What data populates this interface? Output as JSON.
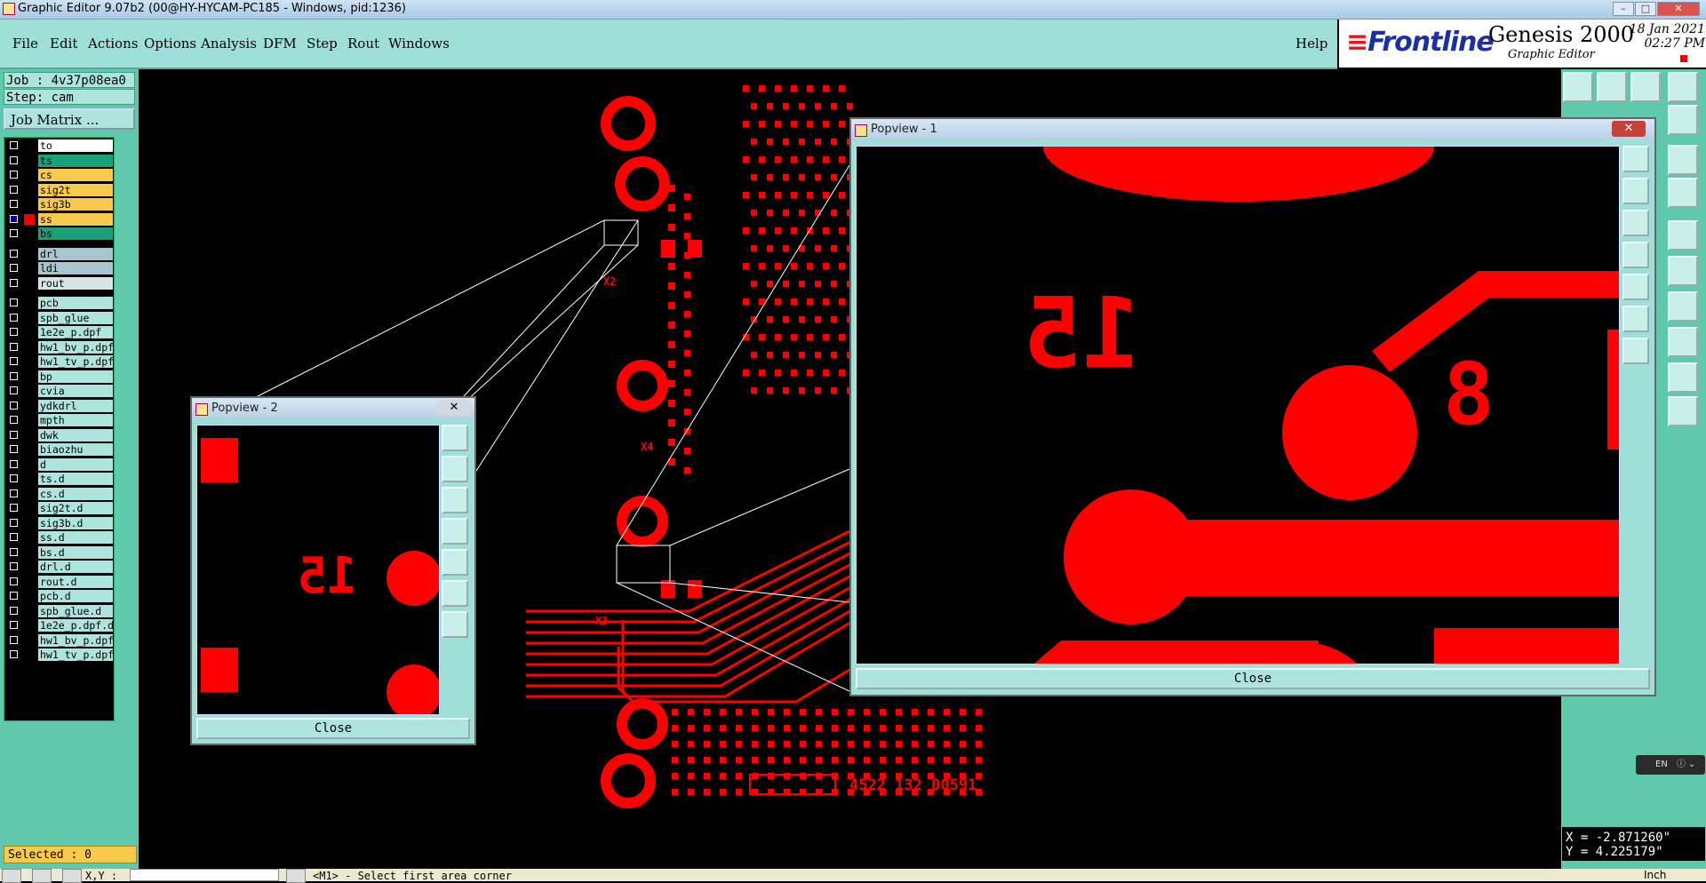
{
  "window": {
    "title": "Graphic Editor 9.07b2 (00@HY-HYCAM-PC185 - Windows, pid:1236)"
  },
  "menubar": {
    "items": [
      "File",
      "Edit",
      "Actions",
      "Options",
      "Analysis",
      "DFM",
      "Step",
      "Rout",
      "Windows"
    ],
    "help": "Help"
  },
  "brand": {
    "frontline": "Frontline",
    "product": "Genesis 2000",
    "subtitle": "Graphic Editor",
    "date": "18 Jan 2021",
    "time": "02:27 PM"
  },
  "job": {
    "job_label": "Job : 4v37p08ea0",
    "step_label": "Step: cam",
    "matrix_button": "Job Matrix ..."
  },
  "layers": [
    {
      "name": "to",
      "color": "#ffffff"
    },
    {
      "name": "ts",
      "color": "#1aa078"
    },
    {
      "name": "cs",
      "color": "#f8c94a"
    },
    {
      "name": "sig2t",
      "color": "#f8c94a"
    },
    {
      "name": "sig3b",
      "color": "#f8c94a"
    },
    {
      "name": "ss",
      "color": "#f8c94a"
    },
    {
      "name": "bs",
      "color": "#1aa078"
    },
    {
      "name": "drl",
      "color": "#a8c4cc"
    },
    {
      "name": "ldi",
      "color": "#a8c4cc"
    },
    {
      "name": "rout",
      "color": "#d8e4e4"
    },
    {
      "name": "pcb",
      "color": "#aee4de"
    },
    {
      "name": "spb_glue",
      "color": "#aee4de"
    },
    {
      "name": "1e2e_p.dpf",
      "color": "#aee4de"
    },
    {
      "name": "hw1_bv_p.dpf",
      "color": "#aee4de"
    },
    {
      "name": "hw1_tv_p.dpf",
      "color": "#aee4de"
    },
    {
      "name": "bp",
      "color": "#aee4de"
    },
    {
      "name": "cvia",
      "color": "#aee4de"
    },
    {
      "name": "ydkdrl",
      "color": "#aee4de"
    },
    {
      "name": "mpth",
      "color": "#aee4de"
    },
    {
      "name": "dwk",
      "color": "#aee4de"
    },
    {
      "name": "biaozhu",
      "color": "#aee4de"
    },
    {
      "name": "d",
      "color": "#aee4de"
    },
    {
      "name": "ts.d",
      "color": "#aee4de"
    },
    {
      "name": "cs.d",
      "color": "#aee4de"
    },
    {
      "name": "sig2t.d",
      "color": "#aee4de"
    },
    {
      "name": "sig3b.d",
      "color": "#aee4de"
    },
    {
      "name": "ss.d",
      "color": "#aee4de"
    },
    {
      "name": "bs.d",
      "color": "#aee4de"
    },
    {
      "name": "drl.d",
      "color": "#aee4de"
    },
    {
      "name": "rout.d",
      "color": "#aee4de"
    },
    {
      "name": "pcb.d",
      "color": "#aee4de"
    },
    {
      "name": "spb_glue.d",
      "color": "#aee4de"
    },
    {
      "name": "1e2e_p.dpf.d",
      "color": "#aee4de"
    },
    {
      "name": "hw1_bv_p.dpf",
      "color": "#aee4de"
    },
    {
      "name": "hw1_tv_p.dpf",
      "color": "#aee4de"
    }
  ],
  "active_layer": "ss",
  "status": {
    "selected": "Selected : 0",
    "xy_label": "X,Y :",
    "prompt": "<M1> - Select first area corner"
  },
  "coords": {
    "x": "X = -2.871260\"",
    "y": "Y = 4.225179\"",
    "units": "Inch"
  },
  "lang_indicator": "EN",
  "board_text": {
    "part_number": "4522 132 00591",
    "label_x2": "X2",
    "label_x4": "X4",
    "label_x3": "X3",
    "label_15": "15",
    "label_8": "8"
  },
  "popview1": {
    "title": "Popview - 1",
    "close_label": "Close"
  },
  "popview2": {
    "title": "Popview - 2",
    "close_label": "Close"
  },
  "colors": {
    "feature": "#ff0000",
    "panel": "#5fc9ae",
    "menubar": "#9edfd8"
  }
}
